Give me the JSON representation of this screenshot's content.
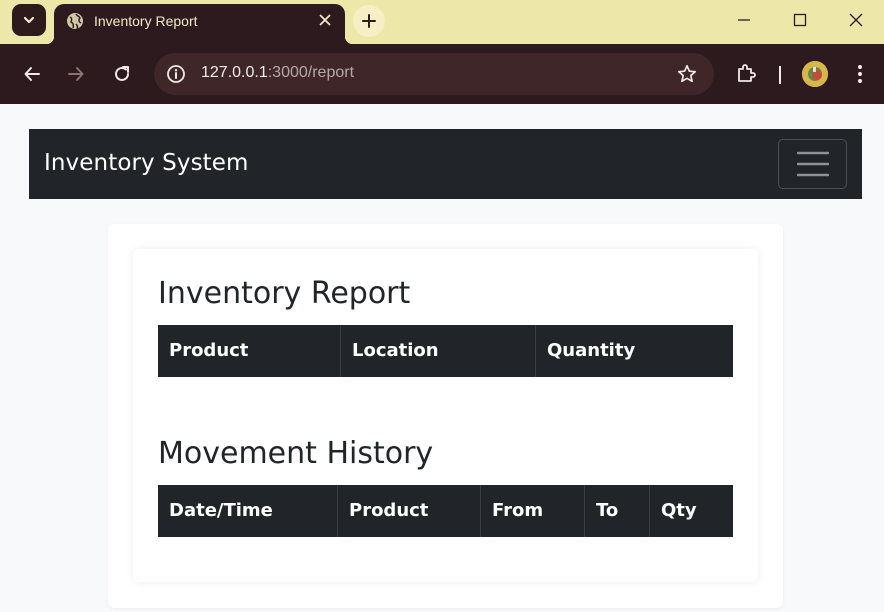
{
  "browser": {
    "tab_title": "Inventory Report",
    "url_host": "127.0.0.1",
    "url_rest": ":3000/report"
  },
  "navbar": {
    "brand": "Inventory System"
  },
  "inventory_report": {
    "title": "Inventory Report",
    "columns": [
      "Product",
      "Location",
      "Quantity"
    ]
  },
  "movement_history": {
    "title": "Movement History",
    "columns": [
      "Date/Time",
      "Product",
      "From",
      "To",
      "Qty"
    ]
  },
  "icons": {
    "tab_menu": "chevron-down-icon",
    "favicon": "globe-icon",
    "close_tab": "close-icon",
    "new_tab": "plus-icon",
    "back": "arrow-left-icon",
    "forward": "arrow-right-icon",
    "reload": "reload-icon",
    "site_info": "info-icon",
    "bookmark": "star-icon",
    "extensions": "puzzle-icon",
    "menu": "kebab-icon",
    "navbar_toggler": "hamburger-icon"
  },
  "colors": {
    "tabbar_bg": "#ede8aa",
    "toolbar_bg": "#2d1a1e",
    "navbar_bg": "#212529",
    "page_bg": "#f8f9fa",
    "table_head_bg": "#212529"
  }
}
